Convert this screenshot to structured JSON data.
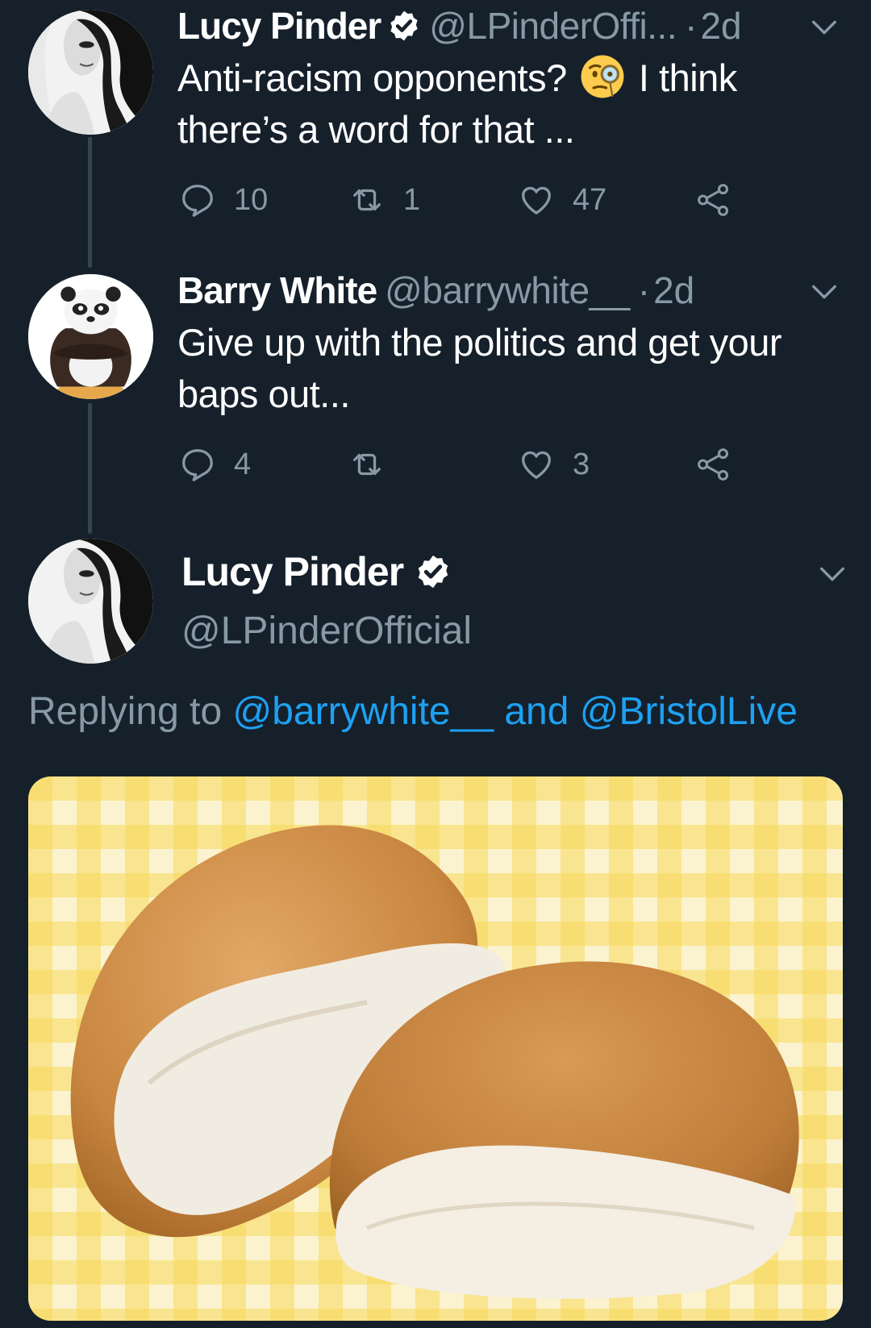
{
  "tweets": [
    {
      "name": "Lucy Pinder",
      "handle": "@LPinderOffi...",
      "dot": "·",
      "time": "2d",
      "text_before_emoji": "Anti-racism opponents?",
      "emoji": "face-with-monocle",
      "text_after_emoji": "I think there’s a word for that ...",
      "replies": "10",
      "retweets": "1",
      "likes": "47"
    },
    {
      "name": "Barry White",
      "handle": "@barrywhite__",
      "dot": "·",
      "time": "2d",
      "text": "Give up with the politics and get your baps out...",
      "replies": "4",
      "retweets": "",
      "likes": "3"
    }
  ],
  "main_tweet": {
    "name": "Lucy Pinder",
    "handle": "@LPinderOfficial",
    "replying_prefix": "Replying to",
    "replying_user1": "@barrywhite__",
    "replying_and": "and",
    "replying_user2": "@BristolLive",
    "media_description": "bread-rolls-image"
  },
  "colors": {
    "background": "#15202b",
    "secondary_text": "#8899a6",
    "link": "#1da1f2",
    "thread_line": "#38444d"
  }
}
